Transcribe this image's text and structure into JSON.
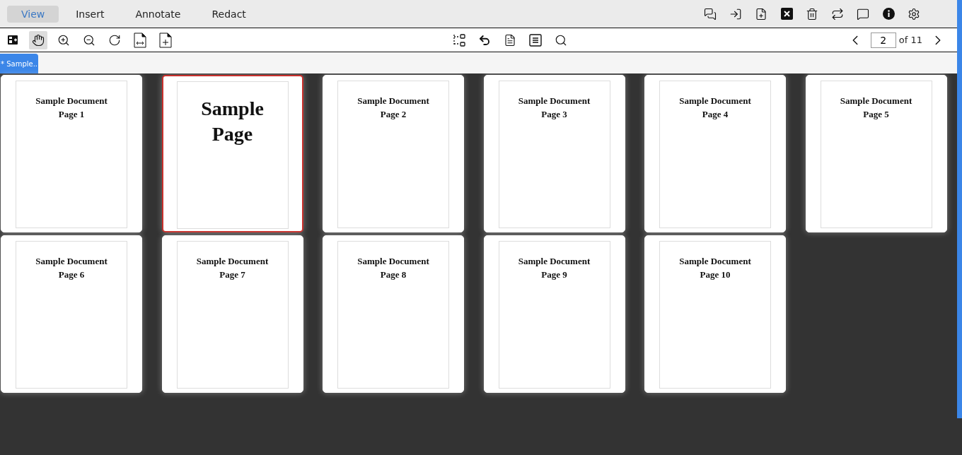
{
  "menu_tabs": [
    {
      "label": "View",
      "selected": true
    },
    {
      "label": "Insert",
      "selected": false
    },
    {
      "label": "Annotate",
      "selected": false
    },
    {
      "label": "Redact",
      "selected": false
    }
  ],
  "header_actions": [
    {
      "kind": "comments"
    },
    {
      "kind": "import"
    },
    {
      "kind": "newpage"
    },
    {
      "kind": "close"
    },
    {
      "kind": "delete"
    },
    {
      "kind": "swap"
    },
    {
      "kind": "comment"
    },
    {
      "kind": "info"
    },
    {
      "kind": "settings"
    }
  ],
  "left_tools": [
    {
      "kind": "sidebar",
      "selected": false
    },
    {
      "kind": "hand",
      "selected": true
    },
    {
      "kind": "zoomin",
      "selected": false
    },
    {
      "kind": "zoomout",
      "selected": false
    },
    {
      "kind": "rotate",
      "selected": false
    },
    {
      "kind": "fitwidth",
      "selected": false
    },
    {
      "kind": "fitpage",
      "selected": false
    }
  ],
  "center_tools": [
    {
      "kind": "select",
      "selected": false
    },
    {
      "kind": "undo",
      "selected": false
    },
    {
      "kind": "document",
      "selected": false
    },
    {
      "kind": "text",
      "selected": false
    },
    {
      "kind": "search",
      "selected": false
    }
  ],
  "pager": {
    "page": "2",
    "total": "of 11"
  },
  "document_tab": {
    "label": "* Sample..",
    "selected": true
  },
  "pages": [
    {
      "kind": "normal",
      "lines": [
        "Sample Document",
        "Page 1"
      ],
      "selected": false
    },
    {
      "kind": "large",
      "lines": [
        "Sample",
        "Page"
      ],
      "selected": true
    },
    {
      "kind": "normal",
      "lines": [
        "Sample Document",
        "Page 2"
      ],
      "selected": false
    },
    {
      "kind": "normal",
      "lines": [
        "Sample Document",
        "Page 3"
      ],
      "selected": false
    },
    {
      "kind": "normal",
      "lines": [
        "Sample Document",
        "Page 4"
      ],
      "selected": false
    },
    {
      "kind": "normal",
      "lines": [
        "Sample Document",
        "Page 5"
      ],
      "selected": false
    },
    {
      "kind": "normal",
      "lines": [
        "Sample Document",
        "Page 6"
      ],
      "selected": false
    },
    {
      "kind": "normal",
      "lines": [
        "Sample Document",
        "Page 7"
      ],
      "selected": false
    },
    {
      "kind": "normal",
      "lines": [
        "Sample Document",
        "Page 8"
      ],
      "selected": false
    },
    {
      "kind": "normal",
      "lines": [
        "Sample Document",
        "Page 9"
      ],
      "selected": false
    },
    {
      "kind": "normal",
      "lines": [
        "Sample Document",
        "Page 10"
      ],
      "selected": false
    }
  ]
}
